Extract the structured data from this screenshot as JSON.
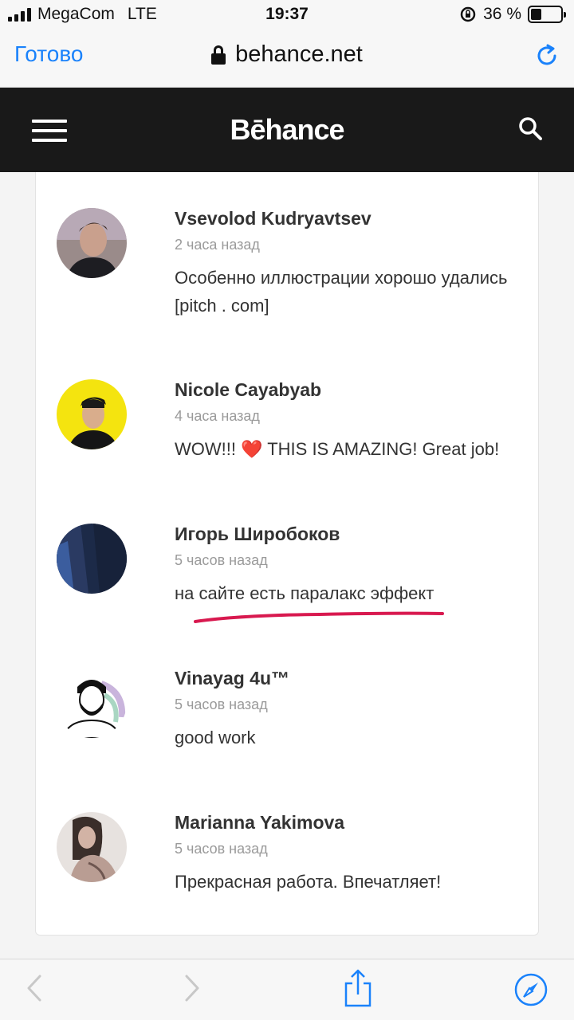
{
  "status_bar": {
    "carrier": "MegaCom",
    "network": "LTE",
    "time": "19:37",
    "battery_percent_label": "36 %",
    "battery_level": 0.36
  },
  "browser": {
    "done_label": "Готово",
    "url": "behance.net"
  },
  "header": {
    "logo": "Bēhance"
  },
  "comments": [
    {
      "name": "Vsevolod Kudryavtsev",
      "time": "2 часа назад",
      "text": "Особенно иллюстрации хорошо удались [pitch . com]"
    },
    {
      "name": "Nicole Cayabyab",
      "time": "4 часа назад",
      "text_before": "WOW!!! ",
      "emoji": "❤️",
      "text_after": " THIS IS AMAZING! Great job!"
    },
    {
      "name": "Игорь Широбоков",
      "time": "5 часов назад",
      "text": "на сайте есть паралакс эффект"
    },
    {
      "name": "Vinayag 4u™",
      "time": "5 часов назад",
      "text": "good work"
    },
    {
      "name": "Marianna Yakimova",
      "time": "5 часов назад",
      "text": "Прекрасная работа. Впечатляет!"
    }
  ],
  "colors": {
    "accent_blue": "#1a82fb",
    "header_bg": "#191919",
    "annotation_red": "#d8194f"
  },
  "icons": [
    "signal-icon",
    "rotation-lock-icon",
    "battery-icon",
    "lock-icon",
    "reload-icon",
    "hamburger-menu-icon",
    "search-icon",
    "back-arrow-icon",
    "forward-arrow-icon",
    "share-icon",
    "compass-icon"
  ]
}
